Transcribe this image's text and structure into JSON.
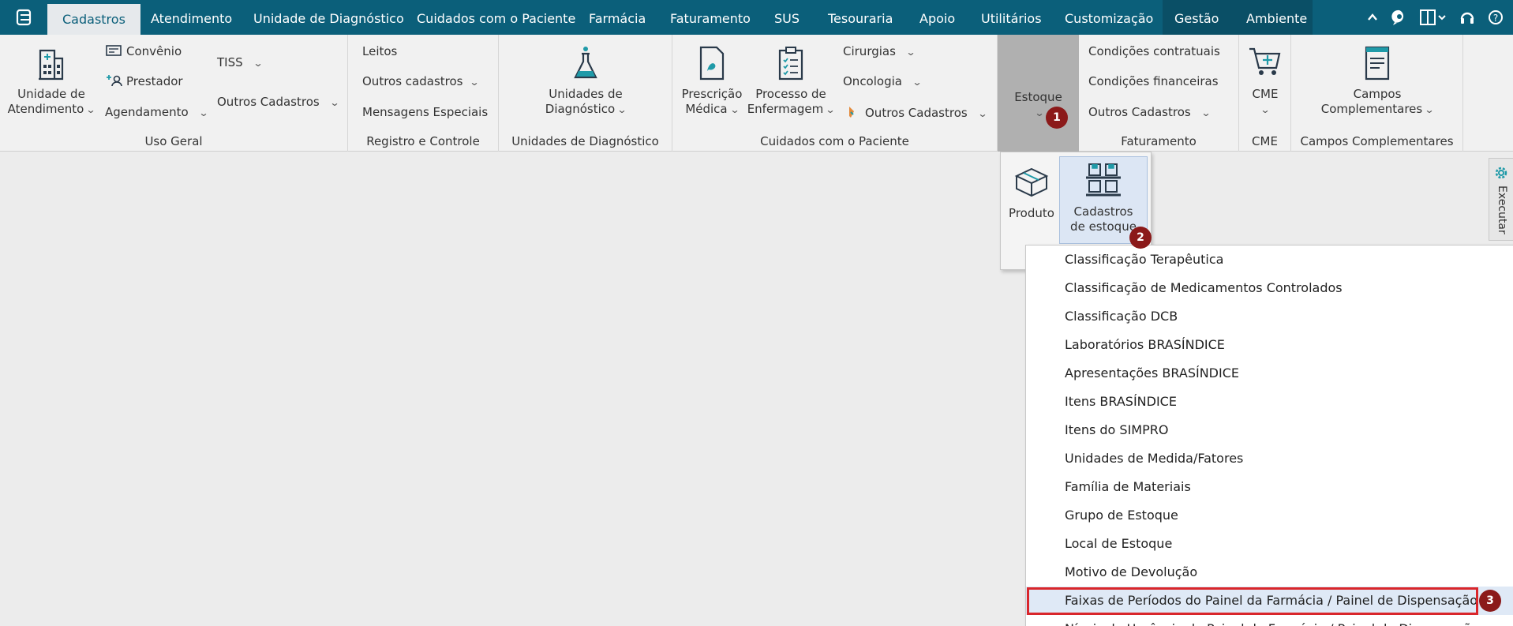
{
  "tabs": [
    {
      "label": "Cadastros",
      "active": true
    },
    {
      "label": "Atendimento"
    },
    {
      "label": "Unidade de Diagnóstico"
    },
    {
      "label": "Cuidados com o Paciente"
    },
    {
      "label": "Farmácia"
    },
    {
      "label": "Faturamento"
    },
    {
      "label": "SUS"
    },
    {
      "label": "Tesouraria"
    },
    {
      "label": "Apoio"
    },
    {
      "label": "Utilitários"
    },
    {
      "label": "Customização"
    },
    {
      "label": "Gestão"
    },
    {
      "label": "Ambiente"
    }
  ],
  "ribbon": {
    "uso_geral": {
      "unidade_line1": "Unidade de",
      "unidade_line2": "Atendimento",
      "convenio": "Convênio",
      "prestador": "Prestador",
      "agendamento": "Agendamento",
      "tiss": "TISS",
      "outros_cadastros": "Outros Cadastros",
      "label": "Uso Geral"
    },
    "registro": {
      "leitos": "Leitos",
      "outros_cadastros": "Outros cadastros",
      "mensagens": "Mensagens  Especiais",
      "label": "Registro e Controle"
    },
    "unidades_diag": {
      "line1": "Unidades de",
      "line2": "Diagnóstico",
      "label": "Unidades de Diagnóstico"
    },
    "cuidados": {
      "prescricao_line1": "Prescrição",
      "prescricao_line2": "Médica",
      "processo_line1": "Processo de",
      "processo_line2": "Enfermagem",
      "cirurgias": "Cirurgias",
      "oncologia": "Oncologia",
      "outros_cadastros": "Outros Cadastros",
      "label": "Cuidados com o Paciente"
    },
    "estoque": {
      "label": "Estoque"
    },
    "faturamento": {
      "condicoes_contratuais": "Condições contratuais",
      "condicoes_financeiras": "Condições financeiras",
      "outros_cadastros": "Outros Cadastros",
      "label": "Faturamento"
    },
    "cme": {
      "button": "CME",
      "label": "CME"
    },
    "campos": {
      "line1": "Campos",
      "line2": "Complementares",
      "label": "Campos Complementares"
    }
  },
  "estoque_panel": {
    "produto": "Produto",
    "cadastros_line1": "Cadastros",
    "cadastros_line2": "de estoque"
  },
  "submenu": [
    "Classificação Terapêutica",
    "Classificação de Medicamentos Controlados",
    "Classificação DCB",
    "Laboratórios BRASÍNDICE",
    "Apresentações BRASÍNDICE",
    "Itens BRASÍNDICE",
    "Itens do SIMPRO",
    "Unidades de Medida/Fatores",
    "Família de Materiais",
    "Grupo de Estoque",
    "Local de Estoque",
    "Motivo de Devolução",
    "Faixas de Períodos do Painel da Farmácia / Painel de Dispensação",
    "Níveis de Urgência do Painel da Farmácia / Painel de Dispensação"
  ],
  "badges": [
    "1",
    "2",
    "3"
  ],
  "side_panel": {
    "label": "Executar"
  },
  "colors": {
    "tabbar": "#0b5f7a",
    "badge": "#8b1a1a",
    "highlight": "#dfe9f6",
    "red_box": "#d9262b"
  }
}
